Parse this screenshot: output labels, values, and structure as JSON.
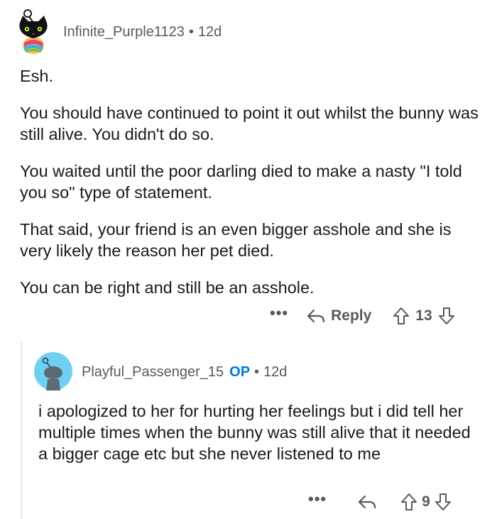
{
  "parent_comment": {
    "username": "Infinite_Purple1123",
    "separator": "•",
    "age": "12d",
    "paragraphs": [
      "Esh.",
      "You should have continued to point it out whilst the bunny was still alive. You didn't do so.",
      "You waited until the poor darling died to make a nasty \"I told you so\" type of statement.",
      "That said, your friend is an even bigger asshole and she is very likely the reason her pet died.",
      "You can be right and still be an asshole."
    ],
    "more_label": "•••",
    "reply_label": "Reply",
    "score": "13"
  },
  "child_comment": {
    "username": "Playful_Passenger_15",
    "op_badge": "OP",
    "separator": "•",
    "age": "12d",
    "text": "i apologized to her for hurting her feelings but i did tell her multiple times when the bunny was still alive that it needed a bigger cage etc but she never listened to me",
    "more_label": "•••",
    "score": "9"
  },
  "colors": {
    "meta_gray": "#57595b",
    "op_blue": "#0079d3",
    "text": "#1a1a1b",
    "thread_line": "#e4e6e8",
    "child_avatar_bg": "#6fd1f1"
  }
}
